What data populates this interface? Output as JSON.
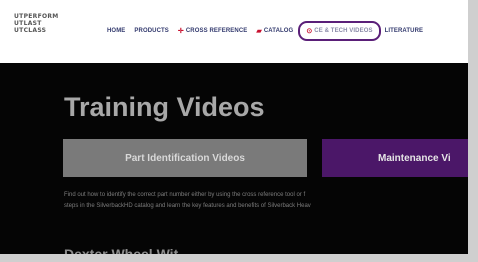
{
  "logo": {
    "lines": [
      "UTPERFORM",
      "UTLAST",
      "UTCLASS"
    ]
  },
  "nav": {
    "items": [
      {
        "label": "HOME",
        "icon": ""
      },
      {
        "label": "PRODUCTS",
        "icon": ""
      },
      {
        "label": "CROSS REFERENCE",
        "icon": "cross-icon"
      },
      {
        "label": "CATALOG",
        "icon": "book-icon"
      },
      {
        "label": "CE & TECH VIDEOS",
        "icon": "play-icon"
      },
      {
        "label": "LITERATURE",
        "icon": ""
      }
    ],
    "highlight_color": "#5a1f78"
  },
  "main": {
    "title": "Training Videos",
    "tabs": [
      {
        "label": "Part Identification Videos",
        "color": "#7a7a7a"
      },
      {
        "label": "Maintenance Vi",
        "color": "#4b1768"
      }
    ],
    "description": [
      "Find out how to identify the correct part number either by using the cross reference tool or f",
      "steps in the SilverbackHD catalog and learn the key features and benefits of Silverback Heav"
    ],
    "section_heading": "Dexter Wheel Wit"
  }
}
